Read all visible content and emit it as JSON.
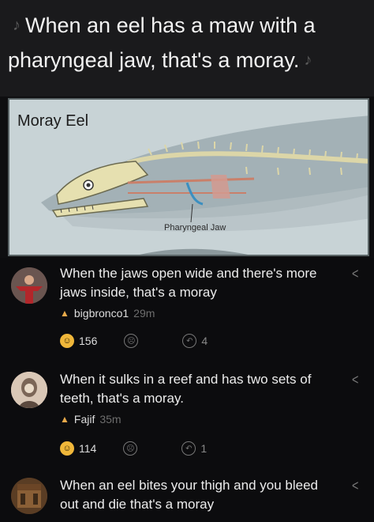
{
  "caption": {
    "line1": "When an eel has a maw with a",
    "line2": "pharyngeal jaw, that's a moray.",
    "note_icon": "music-note-icon"
  },
  "diagram": {
    "title": "Moray Eel",
    "label": "Pharyngeal Jaw"
  },
  "comments": [
    {
      "text": "When the jaws open wide and there's more jaws inside, that's a moray",
      "username": "bigbronco1",
      "age": "29m",
      "likes": "156",
      "replies": "4"
    },
    {
      "text": "When it sulks in a reef and has two sets of teeth, that's a moray.",
      "username": "Fajif",
      "age": "35m",
      "likes": "114",
      "replies": "1"
    },
    {
      "text": "When an eel bites your thigh and you bleed out and die that's a moray"
    }
  ],
  "colors": {
    "accent_gold": "#f0b73a",
    "flame": "#e7a94a",
    "background": "#0c0c0e"
  }
}
